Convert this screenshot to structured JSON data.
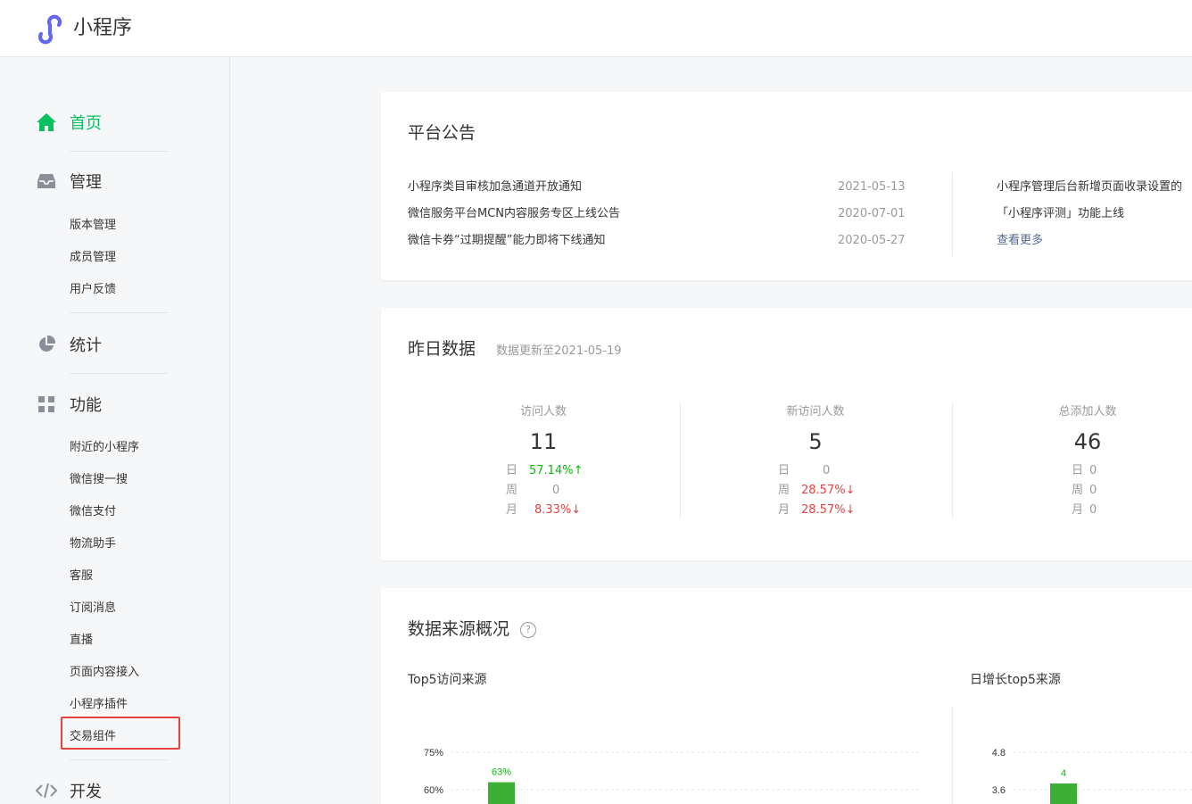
{
  "header": {
    "app_title": "小程序",
    "logo_color": "#6467f0"
  },
  "sidebar": {
    "home": {
      "label": "首页",
      "icon": "home-icon"
    },
    "manage": {
      "label": "管理",
      "icon": "inbox-icon",
      "items": [
        "版本管理",
        "成员管理",
        "用户反馈"
      ]
    },
    "stats": {
      "label": "统计",
      "icon": "pie-chart-icon"
    },
    "features": {
      "label": "功能",
      "icon": "grid-icon",
      "items": [
        "附近的小程序",
        "微信搜一搜",
        "微信支付",
        "物流助手",
        "客服",
        "订阅消息",
        "直播",
        "页面内容接入",
        "小程序插件",
        "交易组件"
      ]
    },
    "dev": {
      "label": "开发",
      "icon": "code-icon"
    },
    "accent_color": "#07c160",
    "highlight_color": "#e64340"
  },
  "announcements": {
    "title": "平台公告",
    "items": [
      {
        "text": "小程序类目审核加急通道开放通知",
        "date": "2021-05-13"
      },
      {
        "text": "微信服务平台MCN内容服务专区上线公告",
        "date": "2020-07-01"
      },
      {
        "text": "微信卡券“过期提醒”能力即将下线通知",
        "date": "2020-05-27"
      }
    ],
    "right_items": [
      "小程序管理后台新增页面收录设置的",
      "「小程序评测」功能上线"
    ],
    "more_label": "查看更多"
  },
  "yesterday": {
    "title": "昨日数据",
    "update_note": "数据更新至2021-05-19",
    "stats": [
      {
        "label": "访问人数",
        "value": "11",
        "rows": [
          {
            "k": "日",
            "v": "57.14%↑",
            "trend": "up"
          },
          {
            "k": "周",
            "v": "0",
            "trend": "flat"
          },
          {
            "k": "月",
            "v": "8.33%↓",
            "trend": "down"
          }
        ]
      },
      {
        "label": "新访问人数",
        "value": "5",
        "rows": [
          {
            "k": "日",
            "v": "0",
            "trend": "flat"
          },
          {
            "k": "周",
            "v": "28.57%↓",
            "trend": "down"
          },
          {
            "k": "月",
            "v": "28.57%↓",
            "trend": "down"
          }
        ]
      },
      {
        "label": "总添加人数",
        "value": "46",
        "rows": [
          {
            "k": "日",
            "v": "0",
            "trend": "flat"
          },
          {
            "k": "周",
            "v": "0",
            "trend": "flat"
          },
          {
            "k": "月",
            "v": "0",
            "trend": "flat"
          }
        ]
      }
    ]
  },
  "sources": {
    "title": "数据来源概况",
    "help_icon": "help-icon",
    "top5_title": "Top5访问来源",
    "growth_title": "日增长top5来源"
  },
  "chart_data": [
    {
      "type": "bar",
      "title": "Top5访问来源",
      "yticks": [
        "75%",
        "60%"
      ],
      "ylim": [
        0,
        75
      ],
      "values": [
        63
      ],
      "data_labels": [
        "63%"
      ],
      "bar_color": "#3cb034"
    },
    {
      "type": "bar",
      "title": "日增长top5来源",
      "yticks": [
        "4.8",
        "3.6"
      ],
      "ylim": [
        0,
        4.8
      ],
      "values": [
        4
      ],
      "data_labels": [
        "4"
      ],
      "bar_color": "#3cb034"
    }
  ]
}
